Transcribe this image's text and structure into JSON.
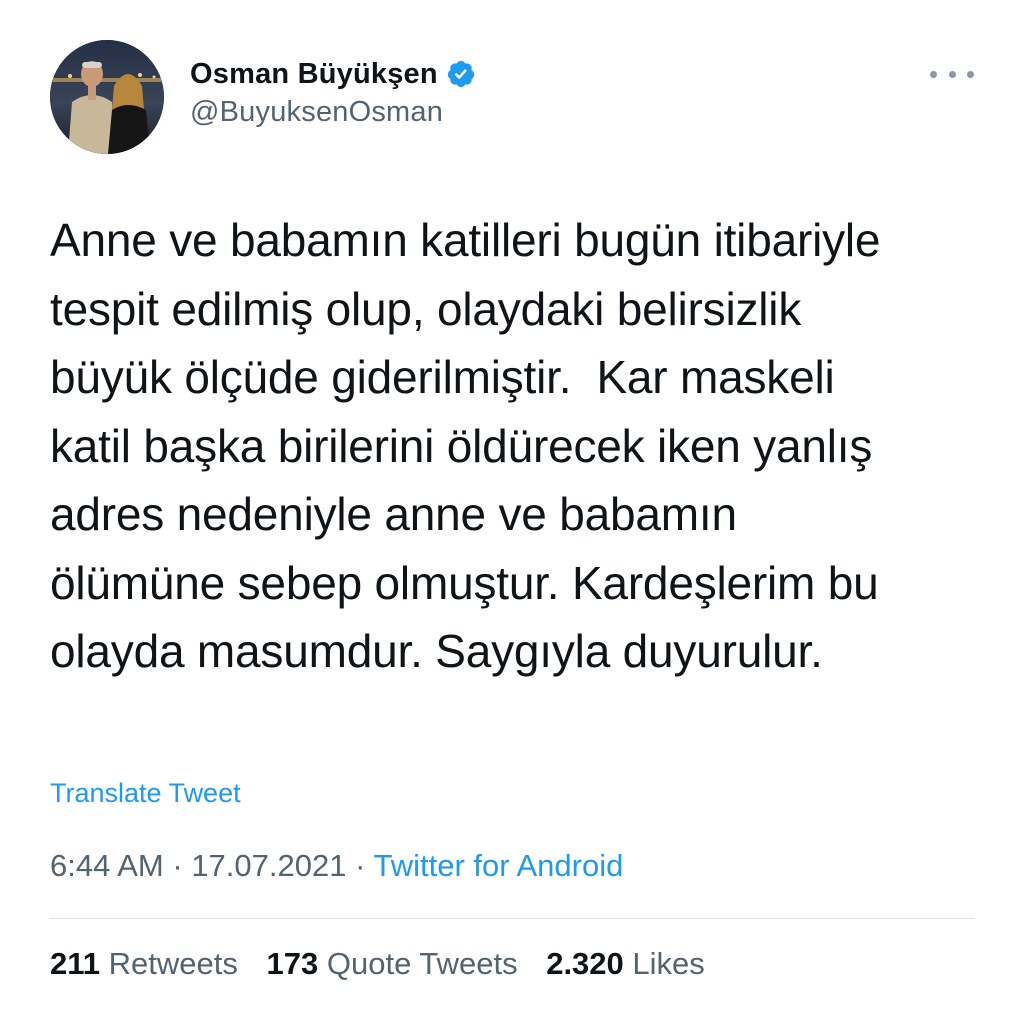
{
  "user": {
    "display_name": "Osman Büyükşen",
    "handle": "@BuyuksenOsman",
    "avatar_icon": "profile-photo",
    "verified_icon": "verified-badge-icon",
    "verified_color": "#1d9bf0"
  },
  "menu": {
    "more_icon": "more-horizontal-icon"
  },
  "tweet": {
    "text": "Anne ve babamın katilleri bugün itibariyle\ntespit edilmiş olup, olaydaki belirsizlik\nbüyük ölçüde giderilmiştir.  Kar maskeli\nkatil başka birilerini öldürecek iken yanlış\nadres nedeniyle anne ve babamın\nölümüne sebep olmuştur. Kardeşlerim bu\nolayda masumdur. Saygıyla duyurulur.",
    "translate_label": "Translate Tweet"
  },
  "meta": {
    "time": "6:44 AM",
    "separator": "·",
    "date": "17.07.2021",
    "source": "Twitter for Android"
  },
  "stats": {
    "retweets_count": "211",
    "retweets_label": "Retweets",
    "quotes_count": "173",
    "quotes_label": "Quote Tweets",
    "likes_count": "2.320",
    "likes_label": "Likes"
  },
  "colors": {
    "link": "#1d9bf0",
    "secondary_text": "#536471",
    "primary_text": "#0f1419",
    "divider": "#dfe3e6"
  }
}
